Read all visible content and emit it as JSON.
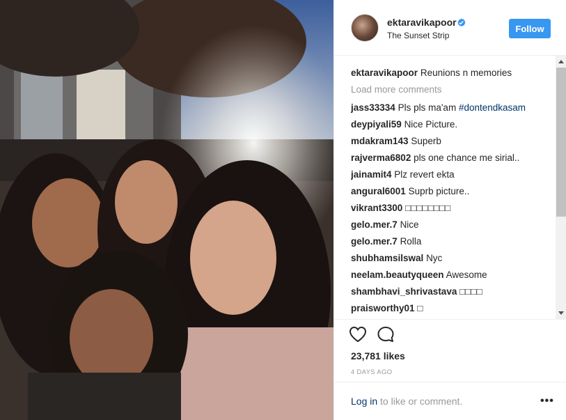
{
  "post": {
    "username": "ektaravikapoor",
    "location": "The Sunset Strip",
    "follow_label": "Follow",
    "caption_user": "ektaravikapoor",
    "caption_text": "Reunions n memories",
    "load_more": "Load more comments",
    "likes": "23,781 likes",
    "time_ago": "4 DAYS AGO",
    "login_link": "Log in",
    "login_text": " to like or comment.",
    "more_icon": "•••"
  },
  "comments": [
    {
      "user": "jass33334",
      "text": "Pls pls ma'am ",
      "tag": "#dontendkasam"
    },
    {
      "user": "deypiyali59",
      "text": "Nice Picture."
    },
    {
      "user": "mdakram143",
      "text": "Superb"
    },
    {
      "user": "rajverma6802",
      "text": "pls one chance me sirial.."
    },
    {
      "user": "jainamit4",
      "text": "Plz revert ekta"
    },
    {
      "user": "angural6001",
      "text": "Suprb picture.."
    },
    {
      "user": "vikrant3300",
      "text": "□□□□□□□□"
    },
    {
      "user": "gelo.mer.7",
      "text": "Nice"
    },
    {
      "user": "gelo.mer.7",
      "text": "Rolla"
    },
    {
      "user": "shubhamsilswal",
      "text": "Nyc"
    },
    {
      "user": "neelam.beautyqueen",
      "text": "Awesome"
    },
    {
      "user": "shambhavi_shrivastava",
      "text": "□□□□"
    },
    {
      "user": "praisworthy01",
      "text": "□"
    }
  ],
  "colors": {
    "follow_button": "#3897f0",
    "verified_badge": "#3897f0",
    "hashtag": "#003569",
    "muted": "#999999"
  },
  "icons": {
    "like": "heart-icon",
    "comment": "comment-bubble-icon",
    "verified": "verified-badge-icon",
    "more": "more-options-icon"
  }
}
